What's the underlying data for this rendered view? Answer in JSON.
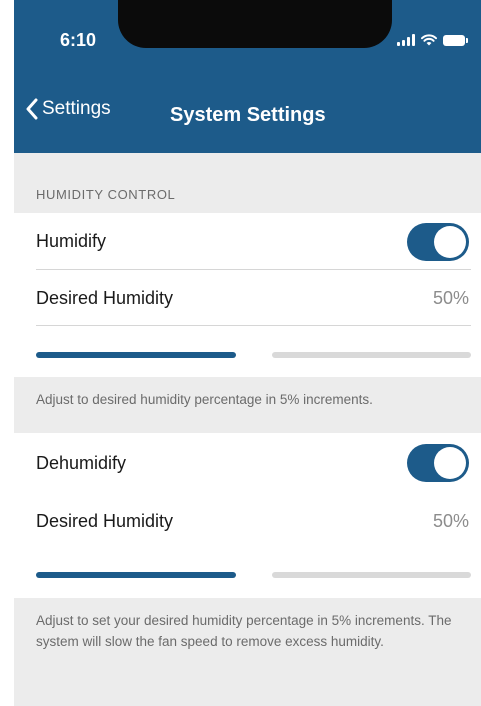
{
  "status_bar": {
    "time": "6:10"
  },
  "nav": {
    "back_label": "Settings",
    "title": "System Settings"
  },
  "humidity_section": {
    "header": "HUMIDITY CONTROL"
  },
  "humidify": {
    "toggle_label": "Humidify",
    "toggle_on": true,
    "desired_label": "Desired Humidity",
    "desired_value": "50%",
    "slider_level": 0.5,
    "footer": "Adjust to desired humidity percentage in 5% increments."
  },
  "dehumidify": {
    "toggle_label": "Dehumidify",
    "toggle_on": true,
    "desired_label": "Desired Humidity",
    "desired_value": "50%",
    "slider_level": 0.5,
    "footer": "Adjust to set your desired humidity percentage in 5% increments. The system will slow the fan speed to remove excess humidity."
  },
  "colors": {
    "accent": "#1d5b8a",
    "background": "#ececec",
    "track_empty": "#d9d9d9"
  },
  "icons": {
    "back": "chevron-left-icon",
    "signal": "cellular-signal-icon",
    "wifi": "wifi-icon",
    "battery": "battery-icon"
  }
}
